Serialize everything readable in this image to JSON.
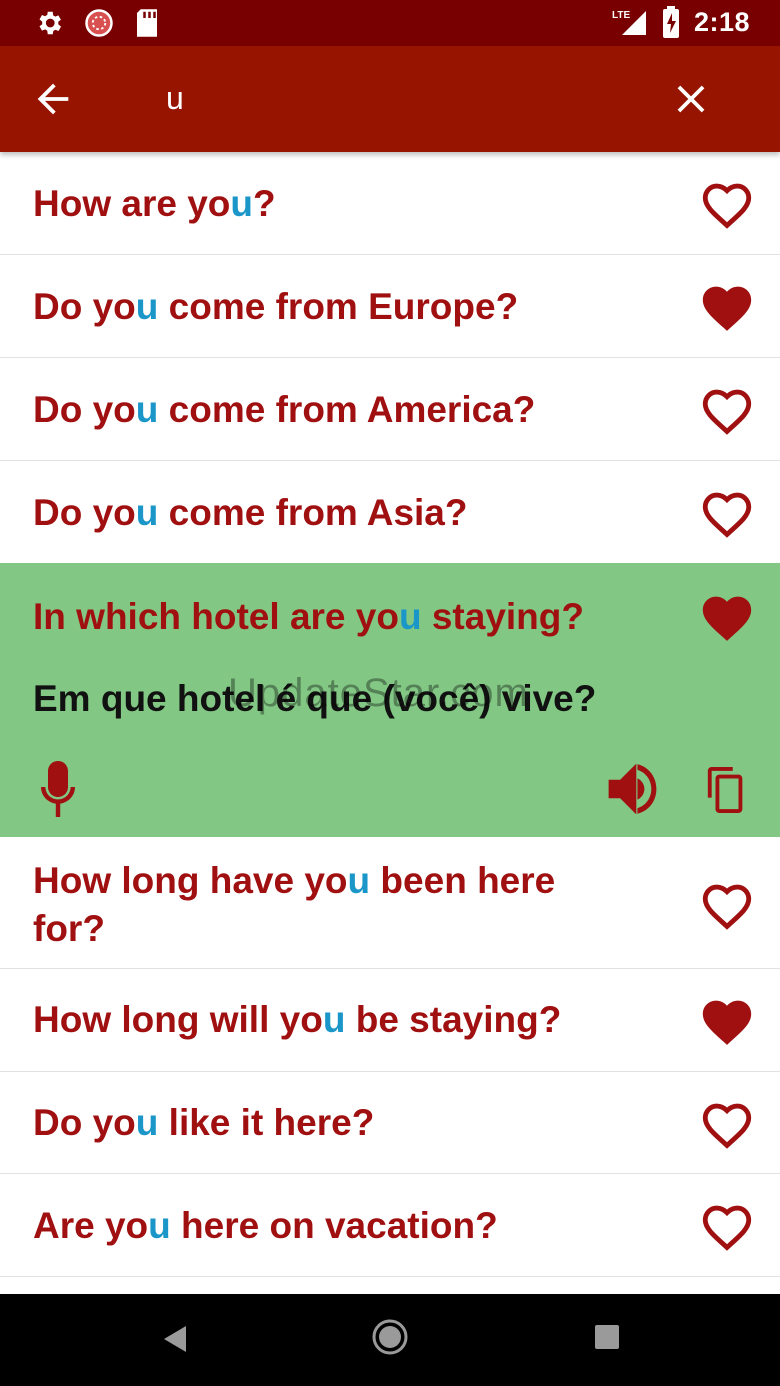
{
  "status_bar": {
    "time": "2:18",
    "network": "LTE",
    "icons": [
      "gear-icon",
      "sync-icon",
      "sd-card-icon",
      "signal-icon",
      "battery-charging-icon"
    ]
  },
  "search": {
    "query": "u",
    "back_icon": "arrow-left-icon",
    "clear_icon": "close-icon"
  },
  "colors": {
    "status_bar": "#790000",
    "app_bar": "#961400",
    "phrase_text": "#a01010",
    "highlight": "#1a96c8",
    "expanded_bg": "#82c784",
    "heart": "#a01010"
  },
  "phrases": [
    {
      "pre": "How are yo",
      "hl": "u",
      "post": "?",
      "favorite": false
    },
    {
      "pre": "Do yo",
      "hl": "u",
      "post": " come from Europe?",
      "favorite": true
    },
    {
      "pre": "Do yo",
      "hl": "u",
      "post": " come from America?",
      "favorite": false
    },
    {
      "pre": "Do yo",
      "hl": "u",
      "post": " come from Asia?",
      "favorite": false
    },
    {
      "pre": "In which hotel are yo",
      "hl": "u",
      "post": " staying?",
      "favorite": true,
      "translation": "Em que hotel é que (você) vive?",
      "watermark": "UpdateStar.com"
    },
    {
      "pre": "How long have yo",
      "hl": "u",
      "post": " been here for?",
      "favorite": false
    },
    {
      "pre": "How long will yo",
      "hl": "u",
      "post": " be staying?",
      "favorite": true
    },
    {
      "pre": "Do yo",
      "hl": "u",
      "post": " like it here?",
      "favorite": false
    },
    {
      "pre": "Are yo",
      "hl": "u",
      "post": " here on vacation?",
      "favorite": false
    }
  ]
}
